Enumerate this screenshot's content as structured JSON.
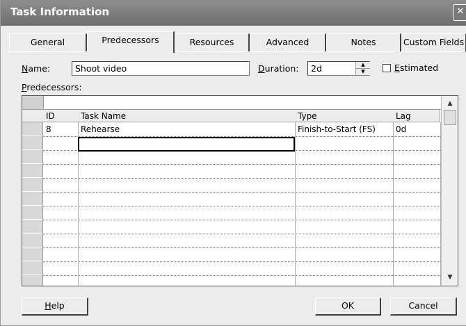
{
  "window": {
    "title": "Task Information",
    "close_glyph": "✕"
  },
  "tabs": [
    {
      "label": "General",
      "active": false
    },
    {
      "label": "Predecessors",
      "active": true
    },
    {
      "label": "Resources",
      "active": false
    },
    {
      "label": "Advanced",
      "active": false
    },
    {
      "label": "Notes",
      "active": false
    },
    {
      "label": "Custom Fields",
      "active": false
    }
  ],
  "form": {
    "name_label_u": "N",
    "name_label_rest": "ame:",
    "name_value": "Shoot video",
    "duration_label_u": "D",
    "duration_label_rest": "uration:",
    "duration_value": "2d",
    "estimated_label_u": "E",
    "estimated_label_rest": "stimated",
    "estimated_checked": false,
    "predecessors_label_u": "P",
    "predecessors_label_rest": "redecessors:"
  },
  "table": {
    "columns": [
      "ID",
      "Task Name",
      "Type",
      "Lag"
    ],
    "rows": [
      {
        "id": "8",
        "task_name": "Rehearse",
        "type": "Finish-to-Start (FS)",
        "lag": "0d"
      }
    ]
  },
  "buttons": {
    "help_u": "H",
    "help_rest": "elp",
    "ok": "OK",
    "cancel": "Cancel"
  },
  "icons": {
    "spin_up": "▲",
    "spin_down": "▼",
    "scroll_up": "▲",
    "scroll_down": "▼"
  }
}
